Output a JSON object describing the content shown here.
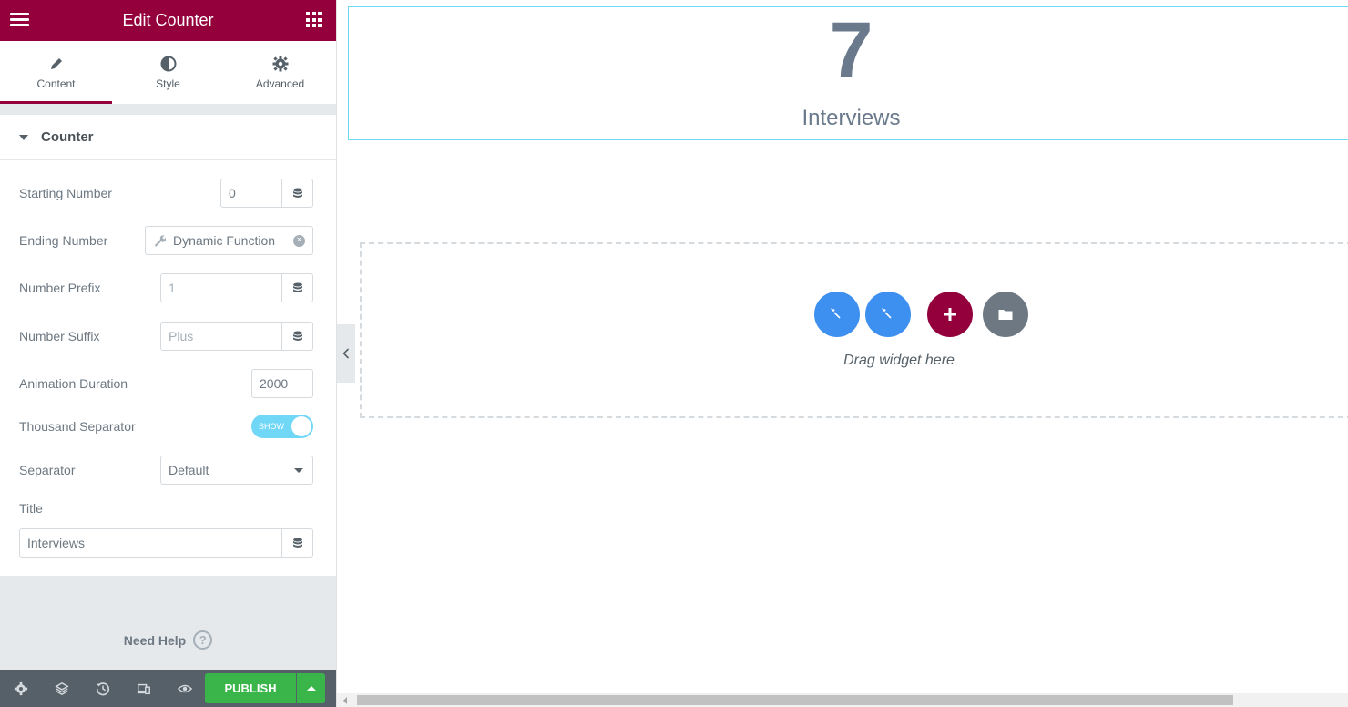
{
  "header": {
    "title": "Edit Counter"
  },
  "tabs": [
    {
      "label": "Content",
      "icon": "pencil-icon",
      "active": true
    },
    {
      "label": "Style",
      "icon": "contrast-icon",
      "active": false
    },
    {
      "label": "Advanced",
      "icon": "gear-icon",
      "active": false
    }
  ],
  "section": {
    "title": "Counter"
  },
  "fields": {
    "starting_number": {
      "label": "Starting Number",
      "value": "0"
    },
    "ending_number": {
      "label": "Ending Number",
      "value": "Dynamic Function"
    },
    "number_prefix": {
      "label": "Number Prefix",
      "placeholder": "1"
    },
    "number_suffix": {
      "label": "Number Suffix",
      "placeholder": "Plus"
    },
    "animation_duration": {
      "label": "Animation Duration",
      "value": "2000"
    },
    "thousand_separator": {
      "label": "Thousand Separator",
      "toggle_text": "SHOW",
      "on": true
    },
    "separator": {
      "label": "Separator",
      "value": "Default"
    },
    "title": {
      "label": "Title",
      "value": "Interviews"
    }
  },
  "help": {
    "label": "Need Help",
    "icon_text": "?"
  },
  "footer": {
    "publish_label": "PUBLISH"
  },
  "preview": {
    "counter_number": "7",
    "counter_title": "Interviews",
    "drop_text": "Drag widget here"
  },
  "colors": {
    "brand": "#93003c",
    "accent": "#71d7f7",
    "publish": "#39b54a",
    "wand_buttons": "#3d8ff0"
  }
}
